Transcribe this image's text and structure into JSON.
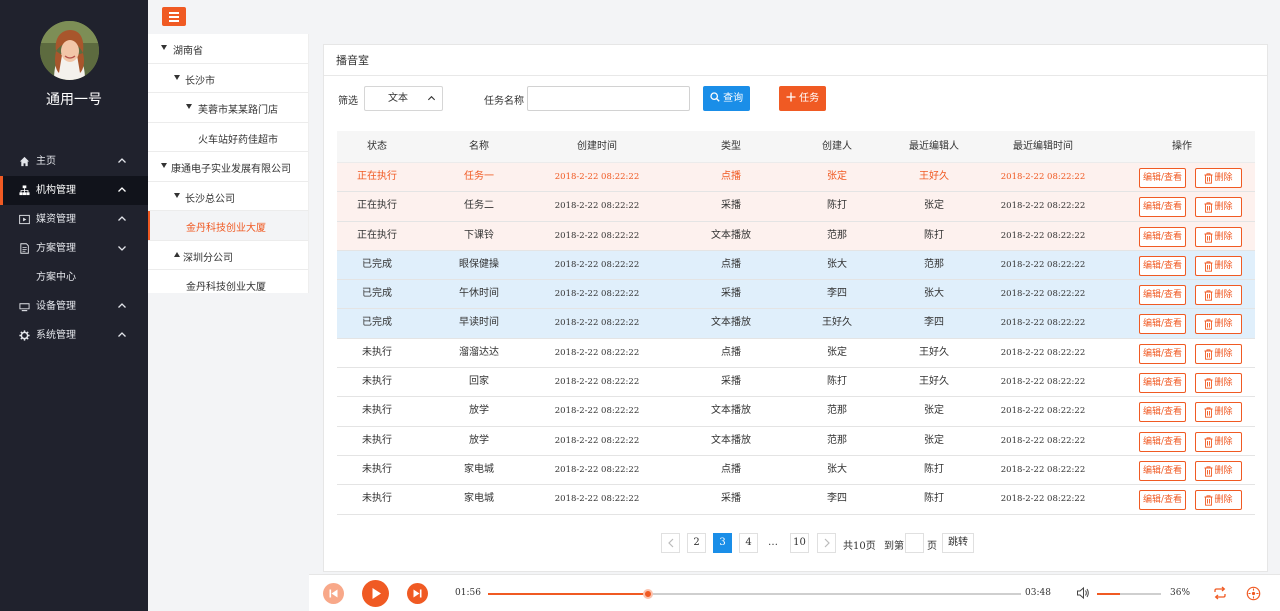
{
  "sidebar": {
    "username": "通用一号",
    "items": [
      {
        "label": "主页",
        "icon": "home-icon",
        "chev": "up"
      },
      {
        "label": "机构管理",
        "icon": "org-chart-icon",
        "chev": "up"
      },
      {
        "label": "媒资管理",
        "icon": "media-icon",
        "chev": "up"
      },
      {
        "label": "方案管理",
        "icon": "document-icon",
        "chev": "down"
      },
      {
        "label": "设备管理",
        "icon": "device-icon",
        "chev": "up"
      },
      {
        "label": "系统管理",
        "icon": "gear-icon",
        "chev": "up"
      }
    ],
    "sub_item": "方案中心",
    "accent": "#f05a23"
  },
  "tree": [
    {
      "label": "湖南省",
      "arrow": "down"
    },
    {
      "label": "长沙市",
      "arrow": "down"
    },
    {
      "label": "芙蓉市某某路门店",
      "arrow": "down"
    },
    {
      "label": "火车站好药佳超市",
      "arrow": ""
    },
    {
      "label": "康通电子实业发展有限公司",
      "arrow": "down"
    },
    {
      "label": "长沙总公司",
      "arrow": "down"
    },
    {
      "label": "金丹科技创业大厦",
      "arrow": "",
      "selected": true
    },
    {
      "label": "深圳分公司",
      "arrow": "up"
    },
    {
      "label": "金丹科技创业大厦",
      "arrow": ""
    }
  ],
  "main": {
    "title": "播音室",
    "filter_label": "筛选",
    "filter_value": "文本",
    "task_name_label": "任务名称",
    "task_name_value": "",
    "query_button": "查询",
    "task_button": "任务"
  },
  "table": {
    "headers": [
      "状态",
      "名称",
      "创建时间",
      "类型",
      "创建人",
      "最近编辑人",
      "最近编辑时间",
      "操作"
    ],
    "edit_label": "编辑/查看",
    "delete_label": "删除",
    "rows": [
      {
        "status": "正在执行",
        "name": "任务一",
        "created": "2018-2-22  08:22:22",
        "type": "点播",
        "creator": "张定",
        "editor": "王好久",
        "edited": "2018-2-22  08:22:22",
        "kind": "running-hl"
      },
      {
        "status": "正在执行",
        "name": "任务二",
        "created": "2018-2-22  08:22:22",
        "type": "采播",
        "creator": "陈打",
        "editor": "张定",
        "edited": "2018-2-22  08:22:22",
        "kind": "running"
      },
      {
        "status": "正在执行",
        "name": "下课铃",
        "created": "2018-2-22  08:22:22",
        "type": "文本播放",
        "creator": "范那",
        "editor": "陈打",
        "edited": "2018-2-22  08:22:22",
        "kind": "running"
      },
      {
        "status": "已完成",
        "name": "眼保健操",
        "created": "2018-2-22  08:22:22",
        "type": "点播",
        "creator": "张大",
        "editor": "范那",
        "edited": "2018-2-22  08:22:22",
        "kind": "done"
      },
      {
        "status": "已完成",
        "name": "午休时间",
        "created": "2018-2-22  08:22:22",
        "type": "采播",
        "creator": "李四",
        "editor": "张大",
        "edited": "2018-2-22  08:22:22",
        "kind": "done"
      },
      {
        "status": "已完成",
        "name": "早读时间",
        "created": "2018-2-22  08:22:22",
        "type": "文本播放",
        "creator": "王好久",
        "editor": "李四",
        "edited": "2018-2-22  08:22:22",
        "kind": "done"
      },
      {
        "status": "未执行",
        "name": "溜溜达达",
        "created": "2018-2-22  08:22:22",
        "type": "点播",
        "creator": "张定",
        "editor": "王好久",
        "edited": "2018-2-22  08:22:22",
        "kind": "idle"
      },
      {
        "status": "未执行",
        "name": "回家",
        "created": "2018-2-22  08:22:22",
        "type": "采播",
        "creator": "陈打",
        "editor": "王好久",
        "edited": "2018-2-22  08:22:22",
        "kind": "idle"
      },
      {
        "status": "未执行",
        "name": "放学",
        "created": "2018-2-22  08:22:22",
        "type": "文本播放",
        "creator": "范那",
        "editor": "张定",
        "edited": "2018-2-22  08:22:22",
        "kind": "idle"
      },
      {
        "status": "未执行",
        "name": "放学",
        "created": "2018-2-22  08:22:22",
        "type": "文本播放",
        "creator": "范那",
        "editor": "张定",
        "edited": "2018-2-22  08:22:22",
        "kind": "idle"
      },
      {
        "status": "未执行",
        "name": "家电城",
        "created": "2018-2-22  08:22:22",
        "type": "点播",
        "creator": "张大",
        "editor": "陈打",
        "edited": "2018-2-22  08:22:22",
        "kind": "idle"
      },
      {
        "status": "未执行",
        "name": "家电城",
        "created": "2018-2-22  08:22:22",
        "type": "采播",
        "creator": "李四",
        "editor": "陈打",
        "edited": "2018-2-22  08:22:22",
        "kind": "idle"
      }
    ]
  },
  "pagination": {
    "pages": [
      "2",
      "3",
      "4",
      "…",
      "10"
    ],
    "current": "3",
    "total_text": "共10页",
    "goto_label": "到第",
    "page_unit": "页",
    "go_button": "跳转"
  },
  "player": {
    "current_time": "01:56",
    "duration": "03:48",
    "progress": 0.3,
    "volume_percent": "36%",
    "volume": 0.36
  }
}
